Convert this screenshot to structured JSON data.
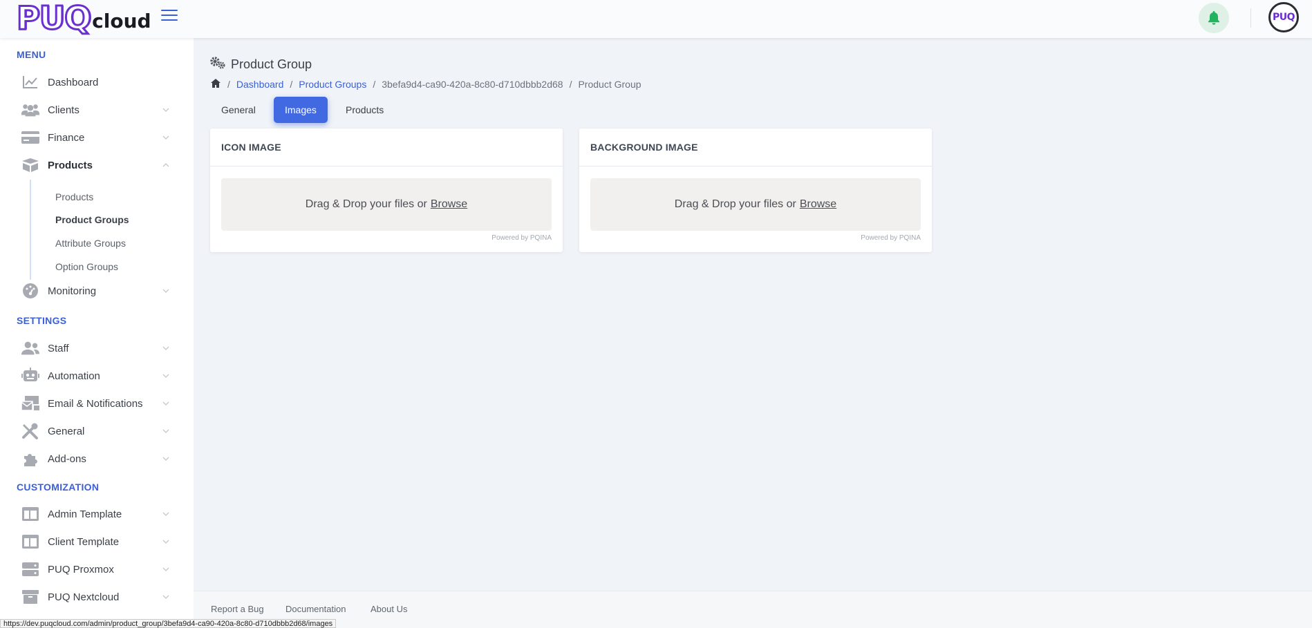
{
  "header": {
    "logo_primary": "PUQ",
    "logo_secondary": "cloud",
    "avatar_text": "PUQ"
  },
  "sidebar": {
    "sections": {
      "menu": "MENU",
      "settings": "SETTINGS",
      "customization": "CUSTOMIZATION"
    },
    "items": {
      "dashboard": "Dashboard",
      "clients": "Clients",
      "finance": "Finance",
      "products": "Products",
      "monitoring": "Monitoring",
      "staff": "Staff",
      "automation": "Automation",
      "email": "Email & Notifications",
      "general": "General",
      "addons": "Add-ons",
      "admin_template": "Admin Template",
      "client_template": "Client Template",
      "puq_proxmox": "PUQ Proxmox",
      "puq_nextcloud": "PUQ Nextcloud"
    },
    "products_sub": {
      "products": "Products",
      "product_groups": "Product Groups",
      "attribute_groups": "Attribute Groups",
      "option_groups": "Option Groups"
    }
  },
  "page": {
    "title": "Product Group",
    "breadcrumb": {
      "dashboard": "Dashboard",
      "product_groups": "Product Groups",
      "id": "3befa9d4-ca90-420a-8c80-d710dbbb2d68",
      "current": "Product Group"
    },
    "tabs": {
      "general": "General",
      "images": "Images",
      "products": "Products"
    },
    "icon_card": {
      "title": "ICON IMAGE",
      "drop_text": "Drag & Drop your files or",
      "browse": "Browse",
      "powered": "Powered by PQINA"
    },
    "background_card": {
      "title": "BACKGROUND IMAGE",
      "drop_text": "Drag & Drop your files or",
      "browse": "Browse",
      "powered": "Powered by PQINA"
    }
  },
  "footer": {
    "report_bug": "Report a Bug",
    "documentation": "Documentation",
    "about_us": "About Us"
  },
  "status_url": "https://dev.puqcloud.com/admin/product_group/3befa9d4-ca90-420a-8c80-d710dbbb2d68/images",
  "colors": {
    "accent": "#4169e1",
    "brand_purple": "#6a2fd0",
    "link": "#3b5fd6"
  }
}
